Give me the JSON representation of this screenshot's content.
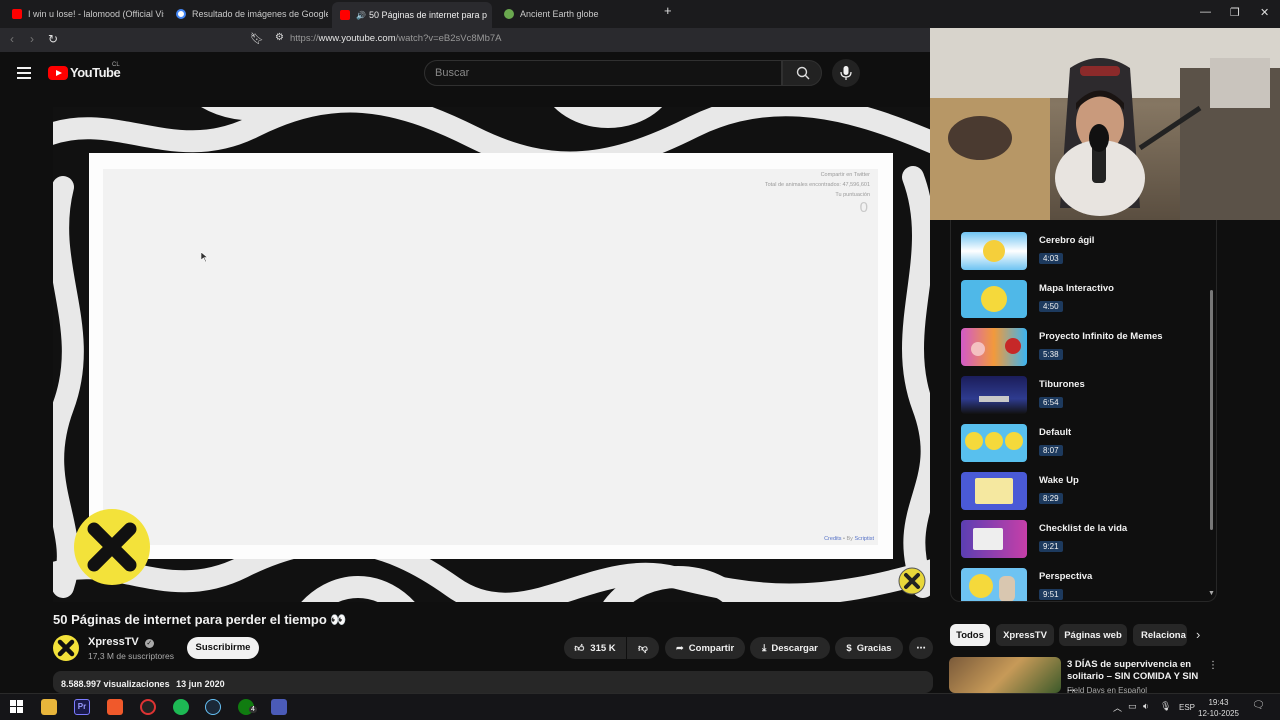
{
  "browser": {
    "tabs": [
      {
        "label": "I win u lose! - lalomood (Official Visu",
        "active": false,
        "favicon_color": "#ff0000"
      },
      {
        "label": "Resultado de imágenes de Google",
        "active": false,
        "favicon_color": "#4285f4"
      },
      {
        "label": "50 Páginas de internet para p",
        "active": true,
        "favicon_color": "#ff0000"
      },
      {
        "label": "Ancient Earth globe",
        "active": false,
        "favicon_color": "#6aa84f"
      }
    ],
    "url_prefix": "https://",
    "url_host": "www.youtube.com",
    "url_path": "/watch?v=eB2sVc8Mb7A"
  },
  "youtube": {
    "logo_text": "YouTube",
    "region": "CL",
    "search_placeholder": "Buscar"
  },
  "video": {
    "inner_page": {
      "share": "Compartir en Twitter",
      "total_label": "Total de animales encontrados: 47,596,601",
      "score_label": "Tu puntuación",
      "score_value": "0",
      "credits": "Credits",
      "by": "• By",
      "author": "Scriptist"
    },
    "title": "50 Páginas de internet para perder el tiempo 👀",
    "channel": "XpressTV",
    "subscribers": "17,3 M de suscriptores",
    "subscribe_label": "Suscribirme",
    "likes": "315 K",
    "share_label": "Compartir",
    "download_label": "Descargar",
    "thanks_label": "Gracias",
    "views": "8.588.997 visualizaciones",
    "date": "13 jun 2020"
  },
  "playlist": [
    {
      "title": "Cerebro ágil",
      "duration": "4:03",
      "thumb": "#6ec3f2"
    },
    {
      "title": "Mapa Interactivo",
      "duration": "4:50",
      "thumb": "#4fb8e8"
    },
    {
      "title": "Proyecto Infinito de Memes",
      "duration": "5:38",
      "thumb": "#d25ac8"
    },
    {
      "title": "Tiburones",
      "duration": "6:54",
      "thumb": "#1b1d5a"
    },
    {
      "title": "Default",
      "duration": "8:07",
      "thumb": "#58c0ee"
    },
    {
      "title": "Wake Up",
      "duration": "8:29",
      "thumb": "#4a5ad6"
    },
    {
      "title": "Checklist de la vida",
      "duration": "9:21",
      "thumb": "#5b3fb3"
    },
    {
      "title": "Perspectiva",
      "duration": "9:51",
      "thumb": "#6ec3f2"
    }
  ],
  "chips": [
    "Todos",
    "XpressTV",
    "Páginas web",
    "Relaciona"
  ],
  "recommended": {
    "title": "3 DÍAS de supervivencia en solitario – SIN COMIDA Y SIN ...",
    "channel": "Field Days en Español"
  },
  "taskbar": {
    "language": "ESP",
    "time": "19:43",
    "date": "12-10-2025",
    "badge": "4"
  }
}
